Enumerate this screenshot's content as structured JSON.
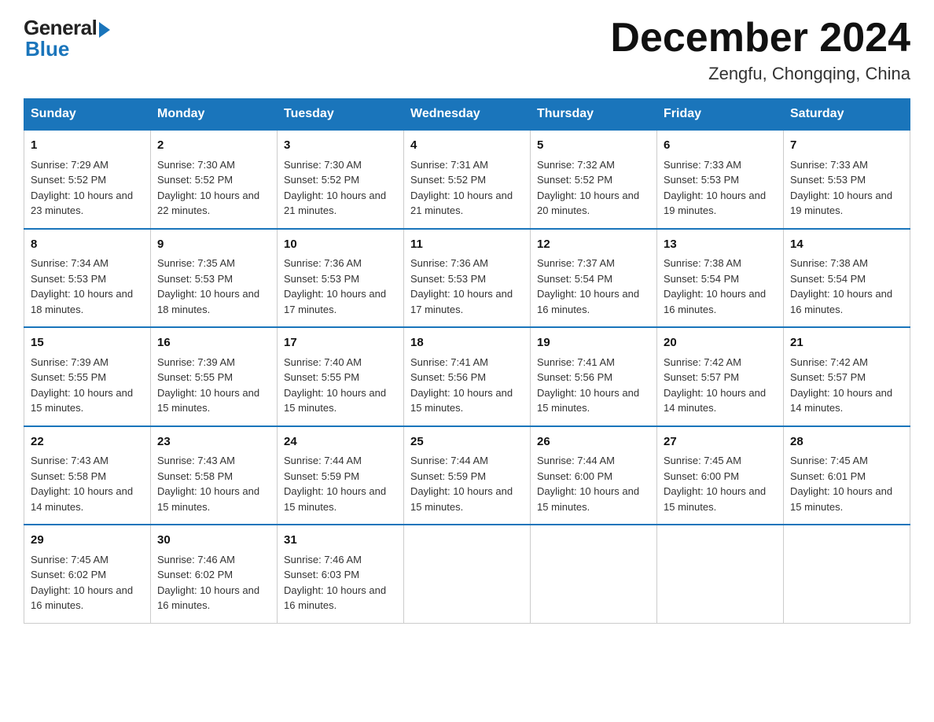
{
  "logo": {
    "general": "General",
    "blue": "Blue"
  },
  "header": {
    "month": "December 2024",
    "location": "Zengfu, Chongqing, China"
  },
  "weekdays": [
    "Sunday",
    "Monday",
    "Tuesday",
    "Wednesday",
    "Thursday",
    "Friday",
    "Saturday"
  ],
  "weeks": [
    [
      {
        "day": "1",
        "sunrise": "7:29 AM",
        "sunset": "5:52 PM",
        "daylight": "10 hours and 23 minutes."
      },
      {
        "day": "2",
        "sunrise": "7:30 AM",
        "sunset": "5:52 PM",
        "daylight": "10 hours and 22 minutes."
      },
      {
        "day": "3",
        "sunrise": "7:30 AM",
        "sunset": "5:52 PM",
        "daylight": "10 hours and 21 minutes."
      },
      {
        "day": "4",
        "sunrise": "7:31 AM",
        "sunset": "5:52 PM",
        "daylight": "10 hours and 21 minutes."
      },
      {
        "day": "5",
        "sunrise": "7:32 AM",
        "sunset": "5:52 PM",
        "daylight": "10 hours and 20 minutes."
      },
      {
        "day": "6",
        "sunrise": "7:33 AM",
        "sunset": "5:53 PM",
        "daylight": "10 hours and 19 minutes."
      },
      {
        "day": "7",
        "sunrise": "7:33 AM",
        "sunset": "5:53 PM",
        "daylight": "10 hours and 19 minutes."
      }
    ],
    [
      {
        "day": "8",
        "sunrise": "7:34 AM",
        "sunset": "5:53 PM",
        "daylight": "10 hours and 18 minutes."
      },
      {
        "day": "9",
        "sunrise": "7:35 AM",
        "sunset": "5:53 PM",
        "daylight": "10 hours and 18 minutes."
      },
      {
        "day": "10",
        "sunrise": "7:36 AM",
        "sunset": "5:53 PM",
        "daylight": "10 hours and 17 minutes."
      },
      {
        "day": "11",
        "sunrise": "7:36 AM",
        "sunset": "5:53 PM",
        "daylight": "10 hours and 17 minutes."
      },
      {
        "day": "12",
        "sunrise": "7:37 AM",
        "sunset": "5:54 PM",
        "daylight": "10 hours and 16 minutes."
      },
      {
        "day": "13",
        "sunrise": "7:38 AM",
        "sunset": "5:54 PM",
        "daylight": "10 hours and 16 minutes."
      },
      {
        "day": "14",
        "sunrise": "7:38 AM",
        "sunset": "5:54 PM",
        "daylight": "10 hours and 16 minutes."
      }
    ],
    [
      {
        "day": "15",
        "sunrise": "7:39 AM",
        "sunset": "5:55 PM",
        "daylight": "10 hours and 15 minutes."
      },
      {
        "day": "16",
        "sunrise": "7:39 AM",
        "sunset": "5:55 PM",
        "daylight": "10 hours and 15 minutes."
      },
      {
        "day": "17",
        "sunrise": "7:40 AM",
        "sunset": "5:55 PM",
        "daylight": "10 hours and 15 minutes."
      },
      {
        "day": "18",
        "sunrise": "7:41 AM",
        "sunset": "5:56 PM",
        "daylight": "10 hours and 15 minutes."
      },
      {
        "day": "19",
        "sunrise": "7:41 AM",
        "sunset": "5:56 PM",
        "daylight": "10 hours and 15 minutes."
      },
      {
        "day": "20",
        "sunrise": "7:42 AM",
        "sunset": "5:57 PM",
        "daylight": "10 hours and 14 minutes."
      },
      {
        "day": "21",
        "sunrise": "7:42 AM",
        "sunset": "5:57 PM",
        "daylight": "10 hours and 14 minutes."
      }
    ],
    [
      {
        "day": "22",
        "sunrise": "7:43 AM",
        "sunset": "5:58 PM",
        "daylight": "10 hours and 14 minutes."
      },
      {
        "day": "23",
        "sunrise": "7:43 AM",
        "sunset": "5:58 PM",
        "daylight": "10 hours and 15 minutes."
      },
      {
        "day": "24",
        "sunrise": "7:44 AM",
        "sunset": "5:59 PM",
        "daylight": "10 hours and 15 minutes."
      },
      {
        "day": "25",
        "sunrise": "7:44 AM",
        "sunset": "5:59 PM",
        "daylight": "10 hours and 15 minutes."
      },
      {
        "day": "26",
        "sunrise": "7:44 AM",
        "sunset": "6:00 PM",
        "daylight": "10 hours and 15 minutes."
      },
      {
        "day": "27",
        "sunrise": "7:45 AM",
        "sunset": "6:00 PM",
        "daylight": "10 hours and 15 minutes."
      },
      {
        "day": "28",
        "sunrise": "7:45 AM",
        "sunset": "6:01 PM",
        "daylight": "10 hours and 15 minutes."
      }
    ],
    [
      {
        "day": "29",
        "sunrise": "7:45 AM",
        "sunset": "6:02 PM",
        "daylight": "10 hours and 16 minutes."
      },
      {
        "day": "30",
        "sunrise": "7:46 AM",
        "sunset": "6:02 PM",
        "daylight": "10 hours and 16 minutes."
      },
      {
        "day": "31",
        "sunrise": "7:46 AM",
        "sunset": "6:03 PM",
        "daylight": "10 hours and 16 minutes."
      },
      null,
      null,
      null,
      null
    ]
  ],
  "labels": {
    "sunrise": "Sunrise:",
    "sunset": "Sunset:",
    "daylight": "Daylight:"
  }
}
